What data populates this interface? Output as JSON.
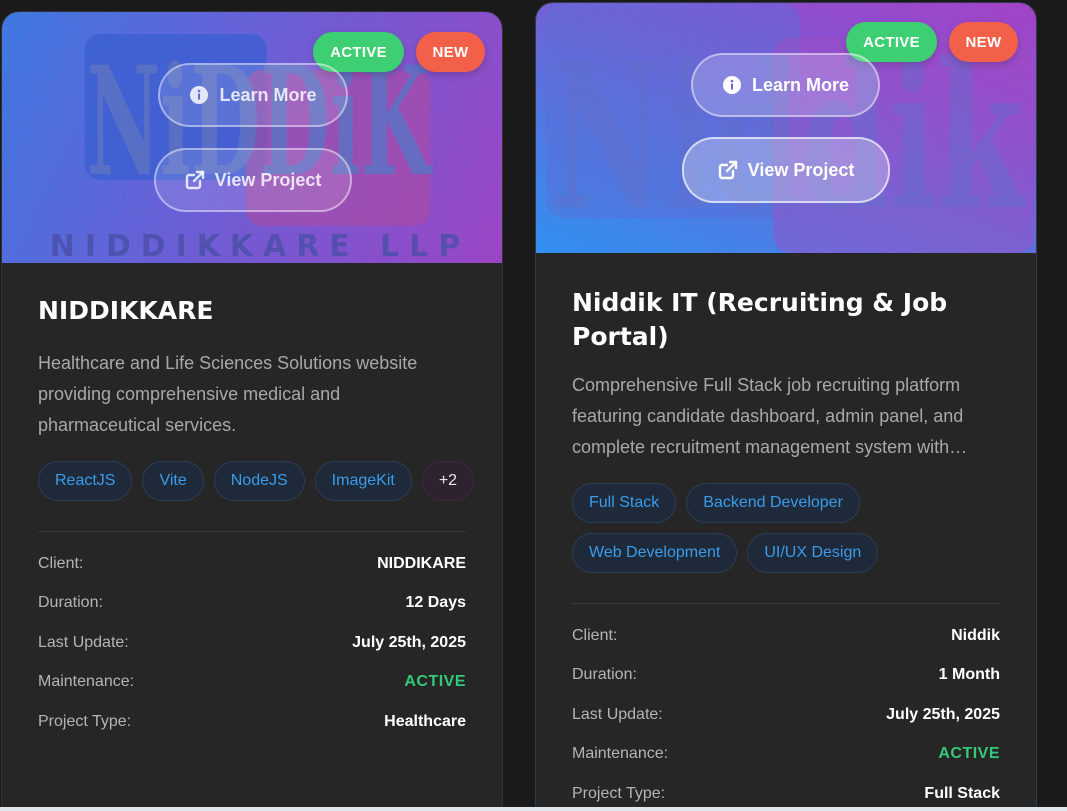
{
  "cards": [
    {
      "logo_big": "NiDDiK",
      "logo_sub": "NIDDIKKARE LLP",
      "badges": {
        "active": "ACTIVE",
        "new": "NEW"
      },
      "learn_more": "Learn More",
      "view_project": "View Project",
      "title": "NIDDIKKARE",
      "description": "Healthcare and Life Sciences Solutions website providing comprehensive medical and pharmaceutical services.",
      "tags": [
        "ReactJS",
        "Vite",
        "NodeJS",
        "ImageKit"
      ],
      "more_tags": "+2",
      "meta": [
        {
          "label": "Client:",
          "value": "NIDDIKARE"
        },
        {
          "label": "Duration:",
          "value": "12 Days"
        },
        {
          "label": "Last Update:",
          "value": "July 25th, 2025"
        },
        {
          "label": "Maintenance:",
          "value": "ACTIVE"
        },
        {
          "label": "Project Type:",
          "value": "Healthcare"
        }
      ]
    },
    {
      "logo_big": "Niddik",
      "badges": {
        "active": "ACTIVE",
        "new": "NEW"
      },
      "learn_more": "Learn More",
      "view_project": "View Project",
      "title": "Niddik IT (Recruiting & Job Portal)",
      "description": "Comprehensive Full Stack job recruiting platform featuring candidate dashboard, admin panel, and complete recruitment management system with…",
      "tags": [
        "Full Stack",
        "Backend Developer",
        "Web Development",
        "UI/UX Design"
      ],
      "meta": [
        {
          "label": "Client:",
          "value": "Niddik"
        },
        {
          "label": "Duration:",
          "value": "1 Month"
        },
        {
          "label": "Last Update:",
          "value": "July 25th, 2025"
        },
        {
          "label": "Maintenance:",
          "value": "ACTIVE"
        },
        {
          "label": "Project Type:",
          "value": "Full Stack"
        }
      ]
    }
  ],
  "colors": {
    "active_green": "#3ecf72",
    "new_red": "#f2604a",
    "tag_blue": "#3b9bea"
  },
  "icons": {
    "learn_more": "info-circle-icon",
    "view_project": "external-link-icon"
  }
}
